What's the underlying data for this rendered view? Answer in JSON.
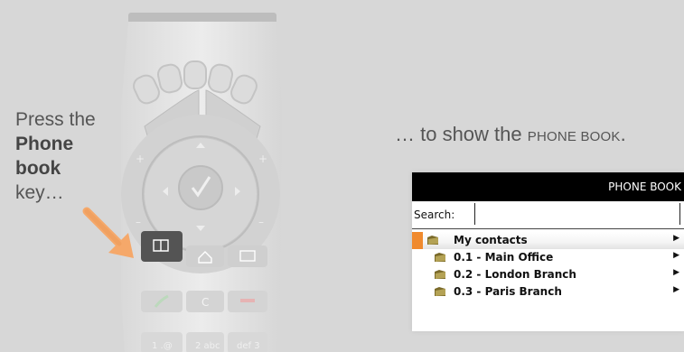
{
  "instruction": {
    "line1": "Press the",
    "bold1": "Phone",
    "bold2": "book",
    "line4": "key…"
  },
  "caption": {
    "prefix": "… to show the ",
    "small_caps": "PHONE BOOK",
    "suffix": "."
  },
  "remote": {
    "clear_key": "C",
    "number_keys": [
      "1 .@",
      "2 abc",
      "def 3"
    ]
  },
  "phonebook": {
    "title": "PHONE BOOK",
    "search_label": "Search:",
    "search_value": "",
    "items": [
      {
        "label": "My contacts",
        "selected": true
      },
      {
        "label": "0.1 - Main Office",
        "selected": false
      },
      {
        "label": "0.2 - London Branch",
        "selected": false
      },
      {
        "label": "0.3 - Paris Branch",
        "selected": false
      }
    ]
  },
  "colors": {
    "accent": "#f08a2e",
    "background": "#d7d7d7",
    "header": "#000000"
  }
}
